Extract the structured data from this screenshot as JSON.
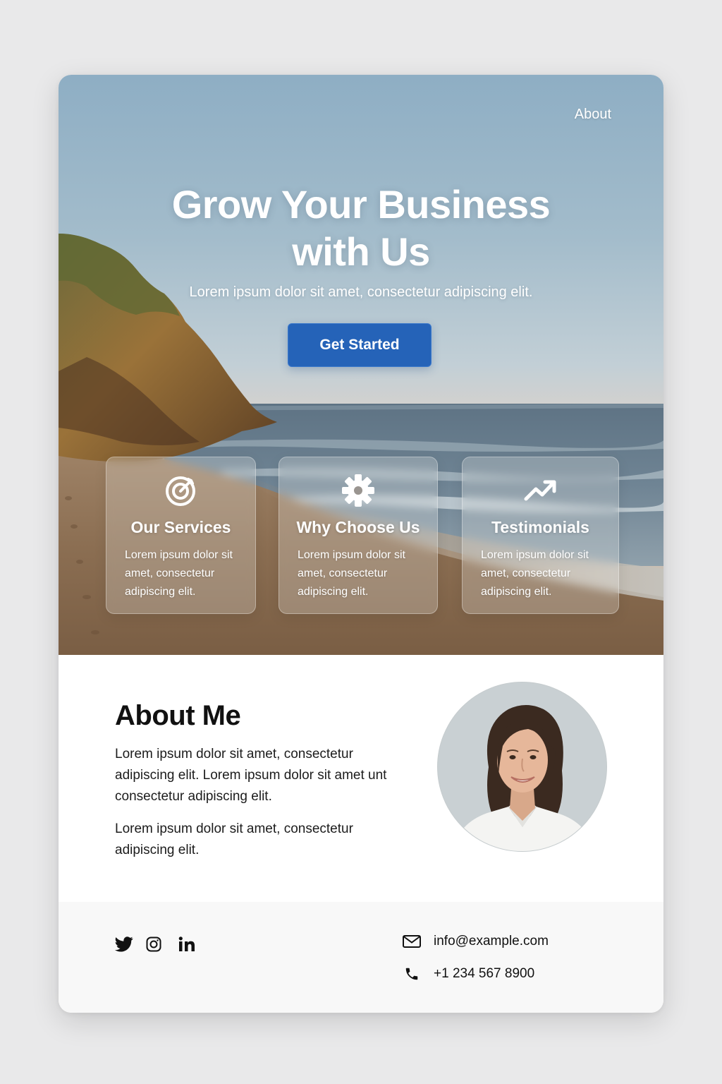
{
  "nav": {
    "about_link": "About"
  },
  "hero": {
    "title_line1": "Grow Your Business",
    "title_line2": "with Us",
    "subtitle": "Lorem ipsum dolor sit amet, consectetur adipiscing elit.",
    "cta_label": "Get Started"
  },
  "features": [
    {
      "icon": "target-icon",
      "title": "Our Services",
      "text": "Lorem ipsum dolor sit amet, consectetur adipiscing elit."
    },
    {
      "icon": "gear-icon",
      "title": "Why Choose Us",
      "text": "Lorem ipsum dolor sit amet, consectetur adipiscing elit."
    },
    {
      "icon": "trend-up-icon",
      "title": "Testimonials",
      "text": "Lorem ipsum dolor sit amet, consectetur adipiscing elit."
    }
  ],
  "about": {
    "title": "About Me",
    "paragraph1": "Lorem ipsum dolor sit amet, consectetur adipiscing elit. Lorem ipsum dolor sit amet unt consectetur adipiscing elit.",
    "paragraph2": "Lorem ipsum dolor sit amet, consectetur adipiscing elit."
  },
  "footer": {
    "social": [
      "twitter-icon",
      "instagram-icon",
      "linkedin-icon"
    ],
    "email": "info@example.com",
    "phone": "+1 234 567 8900"
  },
  "colors": {
    "accent": "#2563b8",
    "page_background": "#e9e9ea",
    "footer_background": "#f8f8f8",
    "text_dark": "#111111"
  }
}
